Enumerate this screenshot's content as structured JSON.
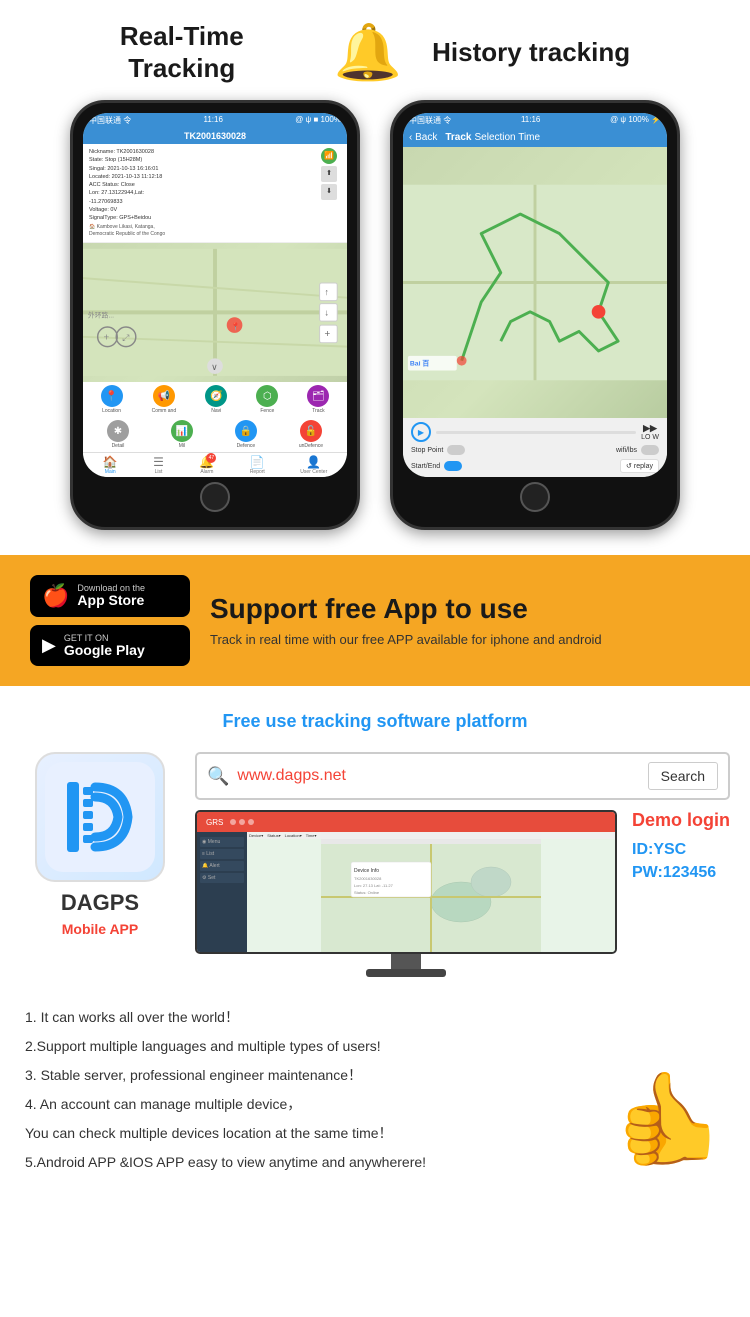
{
  "top": {
    "realtime_title_line1": "Real-Time",
    "realtime_title_line2": "Tracking",
    "history_title": "History tracking",
    "bell_icon": "🔔"
  },
  "phone1": {
    "status_bar": "中国联通 令  11:16  @ ψ ■ 100%",
    "header": "TK2001630028",
    "info_lines": [
      "Nickname: TK2001630028",
      "State: Stop (15H28M)",
      "Singal: 2021-10-13 16:16:01",
      "Located: 2021-10-13 11:12:18",
      "ACC Status: Close",
      "Lon: 27.13122944,Lat:",
      "-11.27069833",
      "Voltage: 0V",
      "SignalType: GPS+Beidou"
    ],
    "location_label": "Kambove Likasi, Katanga, Democratic Republic of the Congo",
    "buttons": [
      {
        "label": "Location",
        "color": "blue"
      },
      {
        "label": "Command",
        "color": "orange"
      },
      {
        "label": "Navi",
        "color": "teal"
      },
      {
        "label": "Fence",
        "color": "green"
      },
      {
        "label": "Track",
        "color": "purple"
      }
    ],
    "buttons2": [
      {
        "label": "Detail",
        "color": "gray"
      },
      {
        "label": "Mil",
        "color": "green"
      },
      {
        "label": "Defence",
        "color": "blue"
      },
      {
        "label": "unDefence",
        "color": "red"
      }
    ],
    "tabs": [
      "Main",
      "List",
      "Alarm",
      "Report",
      "User Center"
    ]
  },
  "phone2": {
    "status_bar": "中国联通 令  11:16  @ ψ 100% ⚡",
    "back": "< Back",
    "header": "Track Selection Time",
    "stop_point": "Stop Point",
    "wifi_lbs": "wifi/lbs",
    "start_end": "Start/End",
    "replay": "replay",
    "low": "LO W"
  },
  "yellow": {
    "app_store_small": "Download on the",
    "app_store_big": "App Store",
    "google_small": "GET IT ON",
    "google_big": "Google Play",
    "support_title": "Support free App to use",
    "support_desc": "Track in real time with our free APP available for iphone and android"
  },
  "platform": {
    "title": "Free use tracking software platform",
    "search_url": "www.dagps.net",
    "search_btn": "Search",
    "search_placeholder": "🔍",
    "app_name": "DAGPS",
    "mobile_app_label": "Mobile APP",
    "demo_login": "Demo login",
    "demo_id": "ID:YSC",
    "demo_pw": "PW:123456"
  },
  "features": {
    "items": [
      "1. It can works all over the world！",
      "2.Support multiple languages and multiple types of users!",
      "3. Stable server, professional engineer maintenance！",
      "4. An account can manage multiple device，",
      "You can check multiple devices location at the same time！",
      "5.Android APP &IOS APP easy to view anytime and anywherere!"
    ]
  }
}
